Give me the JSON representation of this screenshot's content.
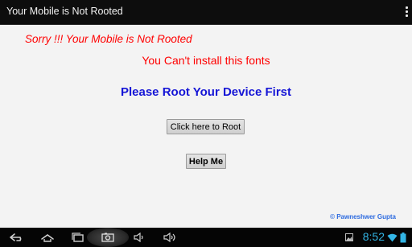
{
  "action_bar": {
    "title": "Your Mobile is Not Rooted",
    "overflow_icon": "overflow-menu-icon"
  },
  "messages": {
    "sorry": "Sorry !!! Your Mobile is Not Rooted",
    "cant_install": "You Can't install this fonts",
    "root_first": "Please Root Your Device First"
  },
  "buttons": {
    "root_label": "Click here to Root",
    "help_label": "Help Me"
  },
  "credit": "© Pawneshwer Gupta",
  "status_bar": {
    "time": "8:52"
  },
  "colors": {
    "error_text": "#ff0000",
    "heading_text": "#1515d6",
    "credit_text": "#2d6be0",
    "status_accent": "#33b5e5"
  }
}
